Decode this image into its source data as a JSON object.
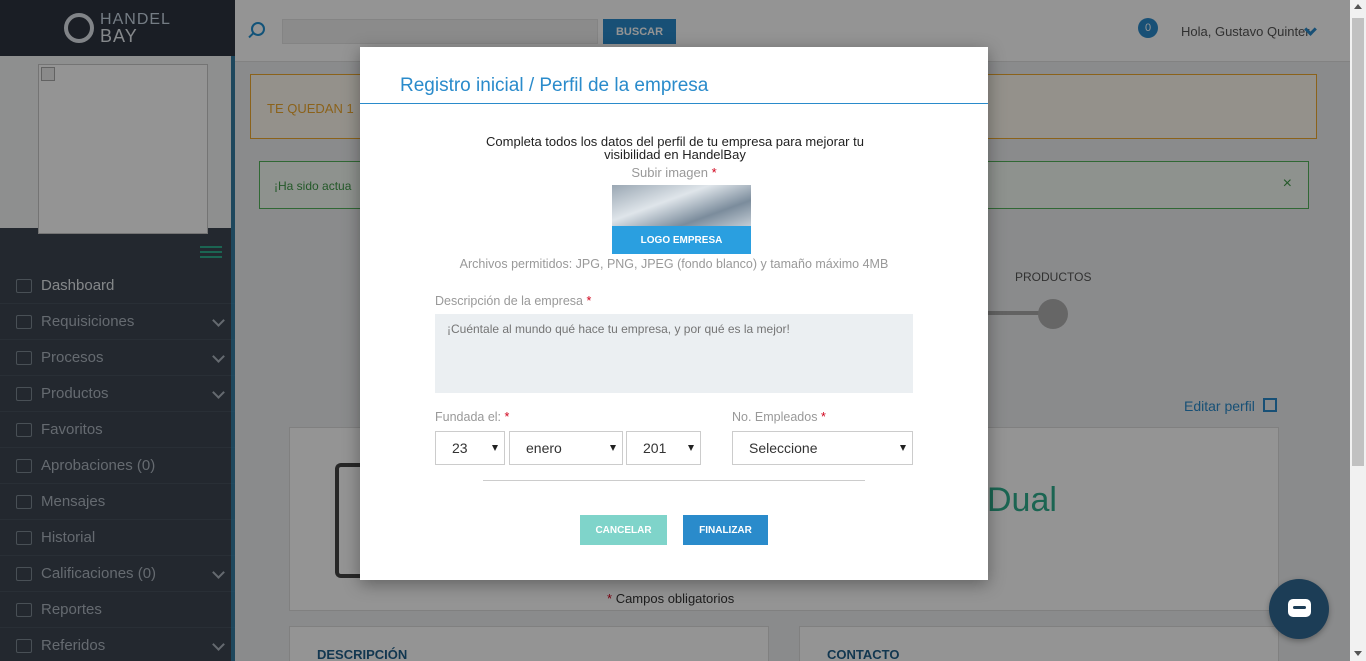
{
  "brand": {
    "line1": "HANDEL",
    "line2": "BAY"
  },
  "sidebar": {
    "items": [
      {
        "label": "Dashboard",
        "icon": "home-icon",
        "has_chevron": false
      },
      {
        "label": "Requisiciones",
        "icon": "clipboard-icon",
        "has_chevron": true
      },
      {
        "label": "Procesos",
        "icon": "stack-icon",
        "has_chevron": true
      },
      {
        "label": "Productos",
        "icon": "box-icon",
        "has_chevron": true
      },
      {
        "label": "Favoritos",
        "icon": "bookmark-icon",
        "has_chevron": false
      },
      {
        "label": "Aprobaciones (0)",
        "icon": "check-icon",
        "has_chevron": false
      },
      {
        "label": "Mensajes",
        "icon": "envelope-icon",
        "has_chevron": false
      },
      {
        "label": "Historial",
        "icon": "folder-icon",
        "has_chevron": false
      },
      {
        "label": "Calificaciones (0)",
        "icon": "square-icon",
        "has_chevron": true
      },
      {
        "label": "Reportes",
        "icon": "stack-icon",
        "has_chevron": false
      },
      {
        "label": "Referidos",
        "icon": "users-icon",
        "has_chevron": true
      }
    ]
  },
  "topbar": {
    "search_button": "BUSCAR",
    "notification_count": "0",
    "greeting": "Hola, Gustavo Quinter"
  },
  "background": {
    "alert_warning": "TE QUEDAN 1",
    "alert_success": "¡Ha sido actua",
    "alert_close": "×",
    "step_label": "PRODUCTOS",
    "edit_profile": "Editar perfil",
    "company_name_fragment": "Dual",
    "required_note": "Campos obligatorios",
    "required_star": "*",
    "card_description": "DESCRIPCIÓN",
    "card_contact": "CONTACTO"
  },
  "modal": {
    "title": "Registro inicial / Perfil de la empresa",
    "intro": "Completa todos los datos del perfil de tu empresa para mejorar tu visibilidad en HandelBay",
    "upload_label": "Subir imagen",
    "required_star": "*",
    "logo_button": "LOGO EMPRESA",
    "formats": "Archivos permitidos: JPG, PNG, JPEG (fondo blanco) y tamaño máximo 4MB",
    "description_label": "Descripción de la empresa",
    "description_placeholder": "¡Cuéntale al mundo qué hace tu empresa, y por qué es la mejor!",
    "founded_label": "Fundada el:",
    "employees_label": "No. Empleados",
    "day_value": "23",
    "month_value": "enero",
    "year_value": "201",
    "employees_value": "Seleccione",
    "cancel_button": "CANCELAR",
    "finish_button": "FINALIZAR"
  },
  "colors": {
    "primary": "#2a8bcb",
    "accent_green": "#2fae8e",
    "warning": "#f0a92e",
    "success": "#54b45a",
    "sidebar_bg": "#3d4652"
  }
}
